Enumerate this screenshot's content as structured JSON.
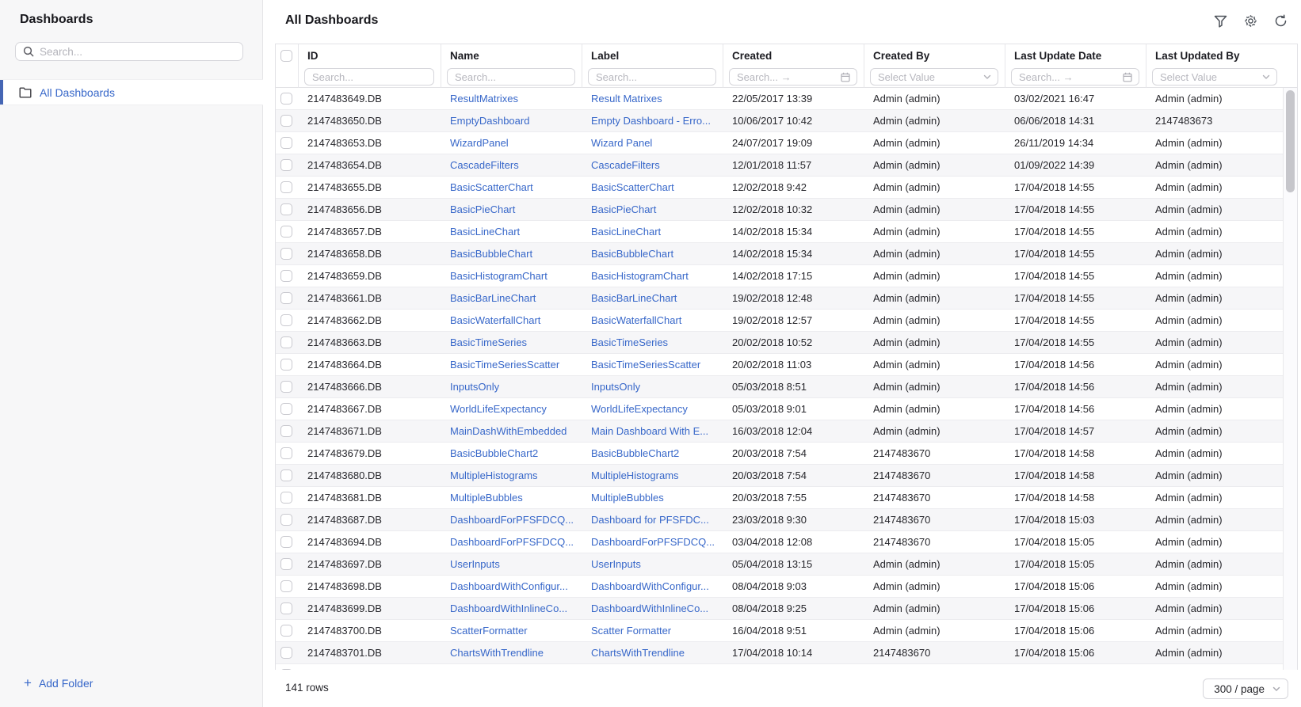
{
  "sidebar": {
    "title": "Dashboards",
    "search_placeholder": "Search...",
    "items": [
      {
        "label": "All Dashboards",
        "selected": true
      }
    ],
    "add_folder_label": "Add Folder",
    "add_folder_plus": "+"
  },
  "header": {
    "title": "All Dashboards",
    "icons": [
      "filter-icon",
      "settings-icon",
      "refresh-icon"
    ]
  },
  "table": {
    "columns": [
      {
        "key": "id",
        "label": "ID",
        "filter": "search",
        "placeholder": "Search..."
      },
      {
        "key": "name",
        "label": "Name",
        "filter": "search",
        "placeholder": "Search..."
      },
      {
        "key": "label",
        "label": "Label",
        "filter": "search",
        "placeholder": "Search..."
      },
      {
        "key": "created",
        "label": "Created",
        "filter": "date",
        "placeholder": "Search... →"
      },
      {
        "key": "created_by",
        "label": "Created By",
        "filter": "select",
        "placeholder": "Select Value"
      },
      {
        "key": "last_update",
        "label": "Last Update Date",
        "filter": "date",
        "placeholder": "Search... →"
      },
      {
        "key": "last_updated_by",
        "label": "Last Updated By",
        "filter": "select",
        "placeholder": "Select Value"
      }
    ],
    "rows": [
      {
        "id": "2147483649.DB",
        "name": "ResultMatrixes",
        "label": "Result Matrixes",
        "created": "22/05/2017 13:39",
        "created_by": "Admin (admin)",
        "last_update": "03/02/2021 16:47",
        "last_updated_by": "Admin (admin)"
      },
      {
        "id": "2147483650.DB",
        "name": "EmptyDashboard",
        "label": "Empty Dashboard - Erro...",
        "created": "10/06/2017 10:42",
        "created_by": "Admin (admin)",
        "last_update": "06/06/2018 14:31",
        "last_updated_by": "2147483673"
      },
      {
        "id": "2147483653.DB",
        "name": "WizardPanel",
        "label": "Wizard Panel",
        "created": "24/07/2017 19:09",
        "created_by": "Admin (admin)",
        "last_update": "26/11/2019 14:34",
        "last_updated_by": "Admin (admin)"
      },
      {
        "id": "2147483654.DB",
        "name": "CascadeFilters",
        "label": "CascadeFilters",
        "created": "12/01/2018 11:57",
        "created_by": "Admin (admin)",
        "last_update": "01/09/2022 14:39",
        "last_updated_by": "Admin (admin)"
      },
      {
        "id": "2147483655.DB",
        "name": "BasicScatterChart",
        "label": "BasicScatterChart",
        "created": "12/02/2018 9:42",
        "created_by": "Admin (admin)",
        "last_update": "17/04/2018 14:55",
        "last_updated_by": "Admin (admin)"
      },
      {
        "id": "2147483656.DB",
        "name": "BasicPieChart",
        "label": "BasicPieChart",
        "created": "12/02/2018 10:32",
        "created_by": "Admin (admin)",
        "last_update": "17/04/2018 14:55",
        "last_updated_by": "Admin (admin)"
      },
      {
        "id": "2147483657.DB",
        "name": "BasicLineChart",
        "label": "BasicLineChart",
        "created": "14/02/2018 15:34",
        "created_by": "Admin (admin)",
        "last_update": "17/04/2018 14:55",
        "last_updated_by": "Admin (admin)"
      },
      {
        "id": "2147483658.DB",
        "name": "BasicBubbleChart",
        "label": "BasicBubbleChart",
        "created": "14/02/2018 15:34",
        "created_by": "Admin (admin)",
        "last_update": "17/04/2018 14:55",
        "last_updated_by": "Admin (admin)"
      },
      {
        "id": "2147483659.DB",
        "name": "BasicHistogramChart",
        "label": "BasicHistogramChart",
        "created": "14/02/2018 17:15",
        "created_by": "Admin (admin)",
        "last_update": "17/04/2018 14:55",
        "last_updated_by": "Admin (admin)"
      },
      {
        "id": "2147483661.DB",
        "name": "BasicBarLineChart",
        "label": "BasicBarLineChart",
        "created": "19/02/2018 12:48",
        "created_by": "Admin (admin)",
        "last_update": "17/04/2018 14:55",
        "last_updated_by": "Admin (admin)"
      },
      {
        "id": "2147483662.DB",
        "name": "BasicWaterfallChart",
        "label": "BasicWaterfallChart",
        "created": "19/02/2018 12:57",
        "created_by": "Admin (admin)",
        "last_update": "17/04/2018 14:55",
        "last_updated_by": "Admin (admin)"
      },
      {
        "id": "2147483663.DB",
        "name": "BasicTimeSeries",
        "label": "BasicTimeSeries",
        "created": "20/02/2018 10:52",
        "created_by": "Admin (admin)",
        "last_update": "17/04/2018 14:55",
        "last_updated_by": "Admin (admin)"
      },
      {
        "id": "2147483664.DB",
        "name": "BasicTimeSeriesScatter",
        "label": "BasicTimeSeriesScatter",
        "created": "20/02/2018 11:03",
        "created_by": "Admin (admin)",
        "last_update": "17/04/2018 14:56",
        "last_updated_by": "Admin (admin)"
      },
      {
        "id": "2147483666.DB",
        "name": "InputsOnly",
        "label": "InputsOnly",
        "created": "05/03/2018 8:51",
        "created_by": "Admin (admin)",
        "last_update": "17/04/2018 14:56",
        "last_updated_by": "Admin (admin)"
      },
      {
        "id": "2147483667.DB",
        "name": "WorldLifeExpectancy",
        "label": "WorldLifeExpectancy",
        "created": "05/03/2018 9:01",
        "created_by": "Admin (admin)",
        "last_update": "17/04/2018 14:56",
        "last_updated_by": "Admin (admin)"
      },
      {
        "id": "2147483671.DB",
        "name": "MainDashWithEmbedded",
        "label": "Main Dashboard With E...",
        "created": "16/03/2018 12:04",
        "created_by": "Admin (admin)",
        "last_update": "17/04/2018 14:57",
        "last_updated_by": "Admin (admin)"
      },
      {
        "id": "2147483679.DB",
        "name": "BasicBubbleChart2",
        "label": "BasicBubbleChart2",
        "created": "20/03/2018 7:54",
        "created_by": "2147483670",
        "last_update": "17/04/2018 14:58",
        "last_updated_by": "Admin (admin)"
      },
      {
        "id": "2147483680.DB",
        "name": "MultipleHistograms",
        "label": "MultipleHistograms",
        "created": "20/03/2018 7:54",
        "created_by": "2147483670",
        "last_update": "17/04/2018 14:58",
        "last_updated_by": "Admin (admin)"
      },
      {
        "id": "2147483681.DB",
        "name": "MultipleBubbles",
        "label": "MultipleBubbles",
        "created": "20/03/2018 7:55",
        "created_by": "2147483670",
        "last_update": "17/04/2018 14:58",
        "last_updated_by": "Admin (admin)"
      },
      {
        "id": "2147483687.DB",
        "name": "DashboardForPFSFDCQ...",
        "label": "Dashboard for PFSFDC...",
        "created": "23/03/2018 9:30",
        "created_by": "2147483670",
        "last_update": "17/04/2018 15:03",
        "last_updated_by": "Admin (admin)"
      },
      {
        "id": "2147483694.DB",
        "name": "DashboardForPFSFDCQ...",
        "label": "DashboardForPFSFDCQ...",
        "created": "03/04/2018 12:08",
        "created_by": "2147483670",
        "last_update": "17/04/2018 15:05",
        "last_updated_by": "Admin (admin)"
      },
      {
        "id": "2147483697.DB",
        "name": "UserInputs",
        "label": "UserInputs",
        "created": "05/04/2018 13:15",
        "created_by": "Admin (admin)",
        "last_update": "17/04/2018 15:05",
        "last_updated_by": "Admin (admin)"
      },
      {
        "id": "2147483698.DB",
        "name": "DashboardWithConfigur...",
        "label": "DashboardWithConfigur...",
        "created": "08/04/2018 9:03",
        "created_by": "Admin (admin)",
        "last_update": "17/04/2018 15:06",
        "last_updated_by": "Admin (admin)"
      },
      {
        "id": "2147483699.DB",
        "name": "DashboardWithInlineCo...",
        "label": "DashboardWithInlineCo...",
        "created": "08/04/2018 9:25",
        "created_by": "Admin (admin)",
        "last_update": "17/04/2018 15:06",
        "last_updated_by": "Admin (admin)"
      },
      {
        "id": "2147483700.DB",
        "name": "ScatterFormatter",
        "label": "Scatter Formatter",
        "created": "16/04/2018 9:51",
        "created_by": "Admin (admin)",
        "last_update": "17/04/2018 15:06",
        "last_updated_by": "Admin (admin)"
      },
      {
        "id": "2147483701.DB",
        "name": "ChartsWithTrendline",
        "label": "ChartsWithTrendline",
        "created": "17/04/2018 10:14",
        "created_by": "2147483670",
        "last_update": "17/04/2018 15:06",
        "last_updated_by": "Admin (admin)"
      }
    ]
  },
  "footer": {
    "row_count": "141 rows",
    "page_size": "300 / page"
  },
  "colors": {
    "link": "#3767c9",
    "accent_bar": "#4566b4",
    "stripe": "#f6f6f8",
    "border": "#e2e2e6"
  }
}
